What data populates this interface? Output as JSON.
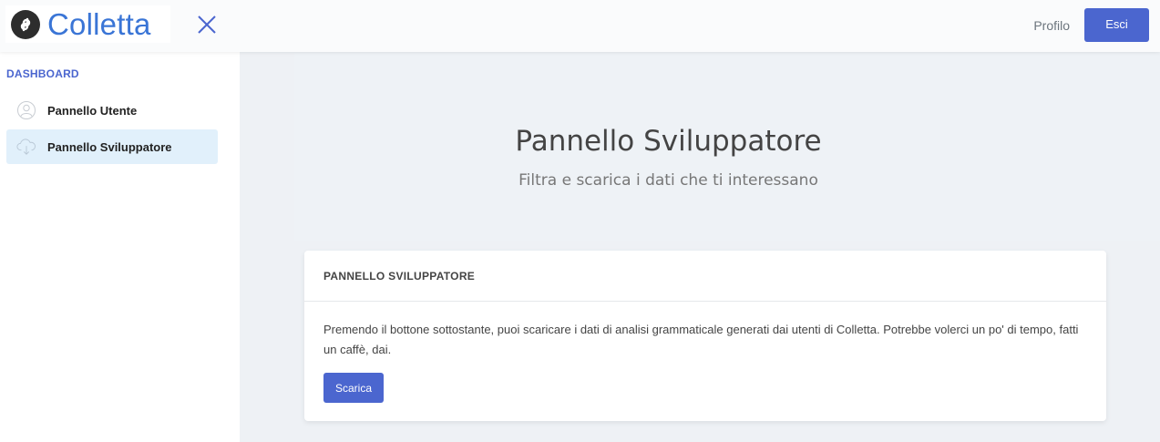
{
  "header": {
    "brand": "Colletta",
    "profile_label": "Profilo",
    "logout_label": "Esci"
  },
  "sidebar": {
    "heading": "DASHBOARD",
    "items": [
      {
        "label": "Pannello Utente",
        "icon": "user-icon",
        "active": false
      },
      {
        "label": "Pannello Sviluppatore",
        "icon": "cloud-download-icon",
        "active": true
      }
    ]
  },
  "hero": {
    "title": "Pannello Sviluppatore",
    "subtitle": "Filtra e scarica i dati che ti interessano"
  },
  "card": {
    "title": "PANNELLO SVILUPPATORE",
    "text": "Premendo il bottone sottostante, puoi scaricare i dati di analisi grammaticale generati dai utenti di Colletta. Potrebbe volerci un po' di tempo, fatti un caffè, dai.",
    "button_label": "Scarica"
  },
  "colors": {
    "accent": "#4b66cf",
    "brand_text": "#3a75d6",
    "active_item_bg": "#e1f0fb"
  }
}
